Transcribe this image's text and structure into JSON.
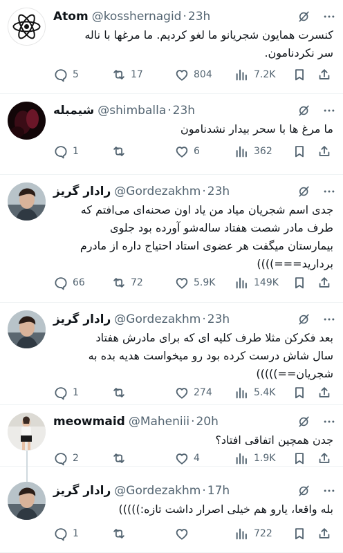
{
  "colors": {
    "text": "#0f1419",
    "secondary": "#536471",
    "divider": "#eff3f4",
    "thread": "#cfd9de"
  },
  "tweets": [
    {
      "display_name": "Atom",
      "handle": "@kosshernagid",
      "dot": "·",
      "time": "23h",
      "text": "کنسرت همایون شجریانو ما لغو کردیم. ما مرغها با ناله\nسر نکردنامون.",
      "avatar": "atom-avatar",
      "replies": "5",
      "retweets": "17",
      "likes": "804",
      "views": "7.2K"
    },
    {
      "display_name": "شیمبله",
      "handle": "@shimballa",
      "dot": "·",
      "time": "23h",
      "text": "ما مرغ ها با سحر بیدار نشدنامون",
      "avatar": "shimballa-avatar",
      "replies": "1",
      "retweets": "",
      "likes": "6",
      "views": "362"
    },
    {
      "display_name": "رادار گریز",
      "handle": "@Gordezakhm",
      "dot": "·",
      "time": "23h",
      "text": "جدی اسم شجریان میاد من یاد اون صحنه‌ای می‌افتم که\nطرف مادر شصت هفتاد ساله‌شو آورده بود جلوی\nبیمارستان میگفت هر عضوی استاد احتیاج داره از مادرم\nبردارید===))))",
      "avatar": "gordezakhm-avatar",
      "replies": "66",
      "retweets": "72",
      "likes": "5.9K",
      "views": "149K"
    },
    {
      "display_name": "رادار گریز",
      "handle": "@Gordezakhm",
      "dot": "·",
      "time": "23h",
      "text": "بعد فکرکن مثلا طرف کلیه ای که برای مادرش هفتاد\nسال شاش درست کرده بود رو میخواست هدیه بده به\nشجریان==)))))",
      "avatar": "gordezakhm-avatar",
      "replies": "1",
      "retweets": "",
      "likes": "274",
      "views": "5.4K"
    },
    {
      "display_name": "meowmaid",
      "handle": "@Maheniii",
      "dot": "·",
      "time": "20h",
      "text": "جدن همچین اتفاقی افتاد؟",
      "avatar": "meowmaid-avatar",
      "replies": "2",
      "retweets": "",
      "likes": "4",
      "views": "1.9K"
    },
    {
      "display_name": "رادار گریز",
      "handle": "@Gordezakhm",
      "dot": "·",
      "time": "17h",
      "text": "بله واقعا، یارو هم خیلی اصرار داشت تازه:)))))",
      "avatar": "gordezakhm-avatar",
      "replies": "1",
      "retweets": "",
      "likes": "",
      "views": "722"
    }
  ]
}
